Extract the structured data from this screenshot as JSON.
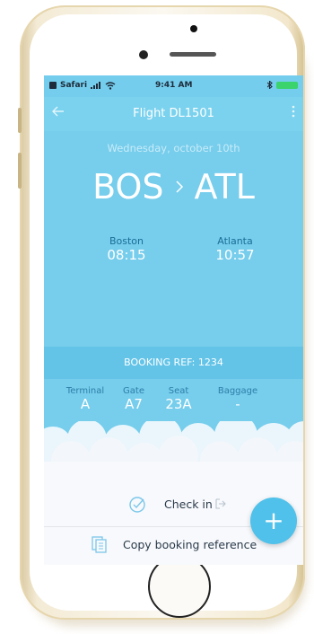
{
  "statusbar": {
    "carrier": "Safari",
    "time": "9:41 AM"
  },
  "appbar": {
    "title": "Flight DL1501"
  },
  "flight": {
    "date": "Wednesday, october 10th",
    "origin_code": "BOS",
    "dest_code": "ATL",
    "origin_city": "Boston",
    "origin_time": "08:15",
    "dest_city": "Atlanta",
    "dest_time": "10:57"
  },
  "booking": {
    "label": "BOOKING REF: 1234"
  },
  "details": [
    {
      "label": "Terminal",
      "value": "A"
    },
    {
      "label": "Gate",
      "value": "A7"
    },
    {
      "label": "Seat",
      "value": "23A"
    },
    {
      "label": "Baggage",
      "value": "-"
    }
  ],
  "actions": {
    "checkin_label": "Check in",
    "copy_label": "Copy booking reference"
  },
  "fab": {
    "glyph": "+"
  },
  "colors": {
    "sky": "#76cdec",
    "booking_band": "#63c4e8",
    "fab": "#4fc1ea",
    "accent_text": "#1b6e96"
  }
}
